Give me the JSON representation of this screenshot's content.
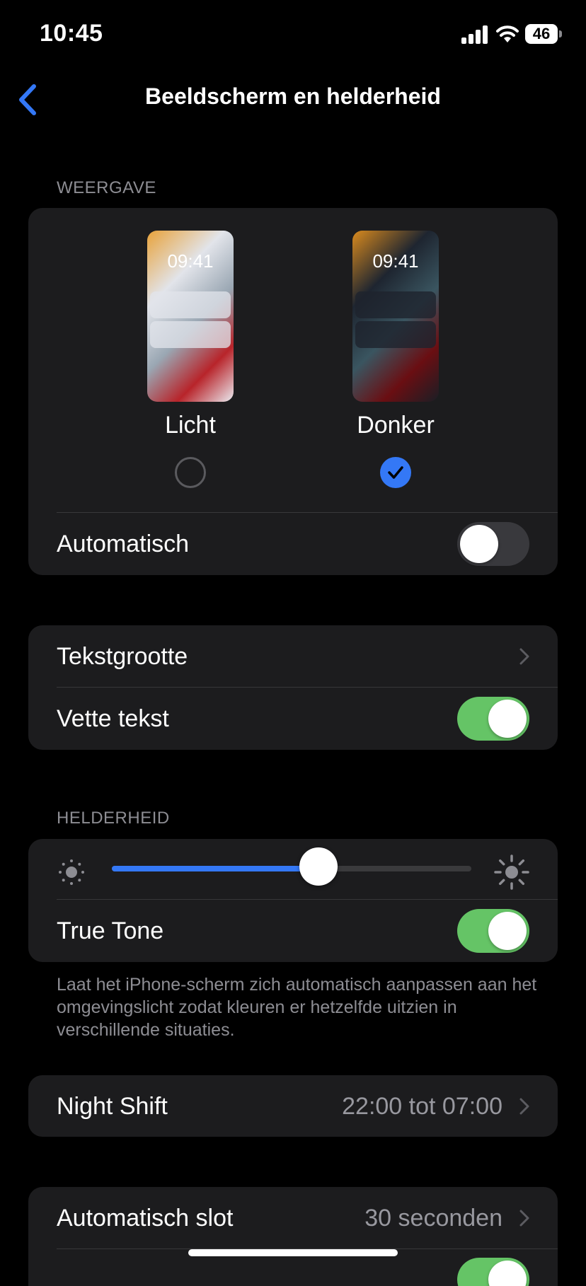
{
  "status_bar": {
    "time": "10:45",
    "battery": "46",
    "icons": [
      "signal-icon",
      "wifi-icon",
      "battery-icon"
    ]
  },
  "nav": {
    "back_icon": "chevron-left-icon",
    "title": "Beeldscherm en helderheid"
  },
  "colors": {
    "accent": "#3478f6",
    "toggle_on": "#65c466",
    "group_bg": "#1c1c1e",
    "secondary_text": "#8d8d93"
  },
  "appearance": {
    "header": "WEERGAVE",
    "light": {
      "preview_time": "09:41",
      "label": "Licht",
      "selected": false
    },
    "dark": {
      "preview_time": "09:41",
      "label": "Donker",
      "selected": true
    },
    "automatic": {
      "label": "Automatisch",
      "on": false
    }
  },
  "text": {
    "text_size": {
      "label": "Tekstgrootte"
    },
    "bold_text": {
      "label": "Vette tekst",
      "on": true
    }
  },
  "brightness": {
    "header": "HELDERHEID",
    "level": 0.575,
    "icons": [
      "sun-min-icon",
      "sun-max-icon"
    ],
    "true_tone": {
      "label": "True Tone",
      "on": true
    },
    "footer": "Laat het iPhone-scherm zich automatisch aanpassen aan het omgevingslicht zodat kleuren er hetzelfde uitzien in verschillende situaties."
  },
  "night_shift": {
    "label": "Night Shift",
    "value": "22:00 tot 07:00"
  },
  "auto_lock": {
    "label": "Automatisch slot",
    "value": "30 seconden"
  }
}
